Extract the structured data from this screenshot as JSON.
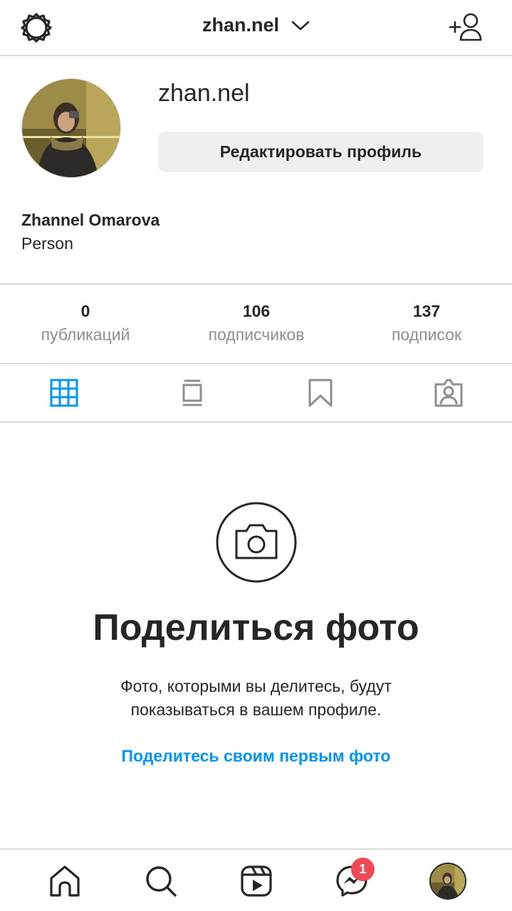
{
  "header": {
    "username": "zhan.nel",
    "icons": {
      "settings": "gear-icon",
      "account_switch": "chevron-down-icon",
      "add_user": "add-user-icon"
    }
  },
  "profile": {
    "handle": "zhan.nel",
    "edit_button_label": "Редактировать профиль",
    "full_name": "Zhannel Omarova",
    "category": "Person"
  },
  "stats": [
    {
      "value": "0",
      "label": "публикаций"
    },
    {
      "value": "106",
      "label": "подписчиков"
    },
    {
      "value": "137",
      "label": "подписок"
    }
  ],
  "tabs": [
    {
      "icon": "grid-icon",
      "active": true
    },
    {
      "icon": "igtv-icon",
      "active": false
    },
    {
      "icon": "bookmark-icon",
      "active": false
    },
    {
      "icon": "tagged-icon",
      "active": false
    }
  ],
  "empty_state": {
    "icon": "camera-icon",
    "title": "Поделиться фото",
    "description": "Фото, которыми вы делитесь, будут показываться в вашем профиле.",
    "link": "Поделитесь своим первым фото"
  },
  "bottom_nav": {
    "items": [
      "home-icon",
      "search-icon",
      "reels-icon",
      "messenger-icon",
      "profile-avatar"
    ],
    "messenger_badge": "1"
  },
  "colors": {
    "accent": "#0095f6",
    "text": "#262626",
    "secondary_text": "#8e8e8e",
    "divider": "#dbdbdb",
    "button_bg": "#efefef",
    "badge": "#ed4956"
  }
}
